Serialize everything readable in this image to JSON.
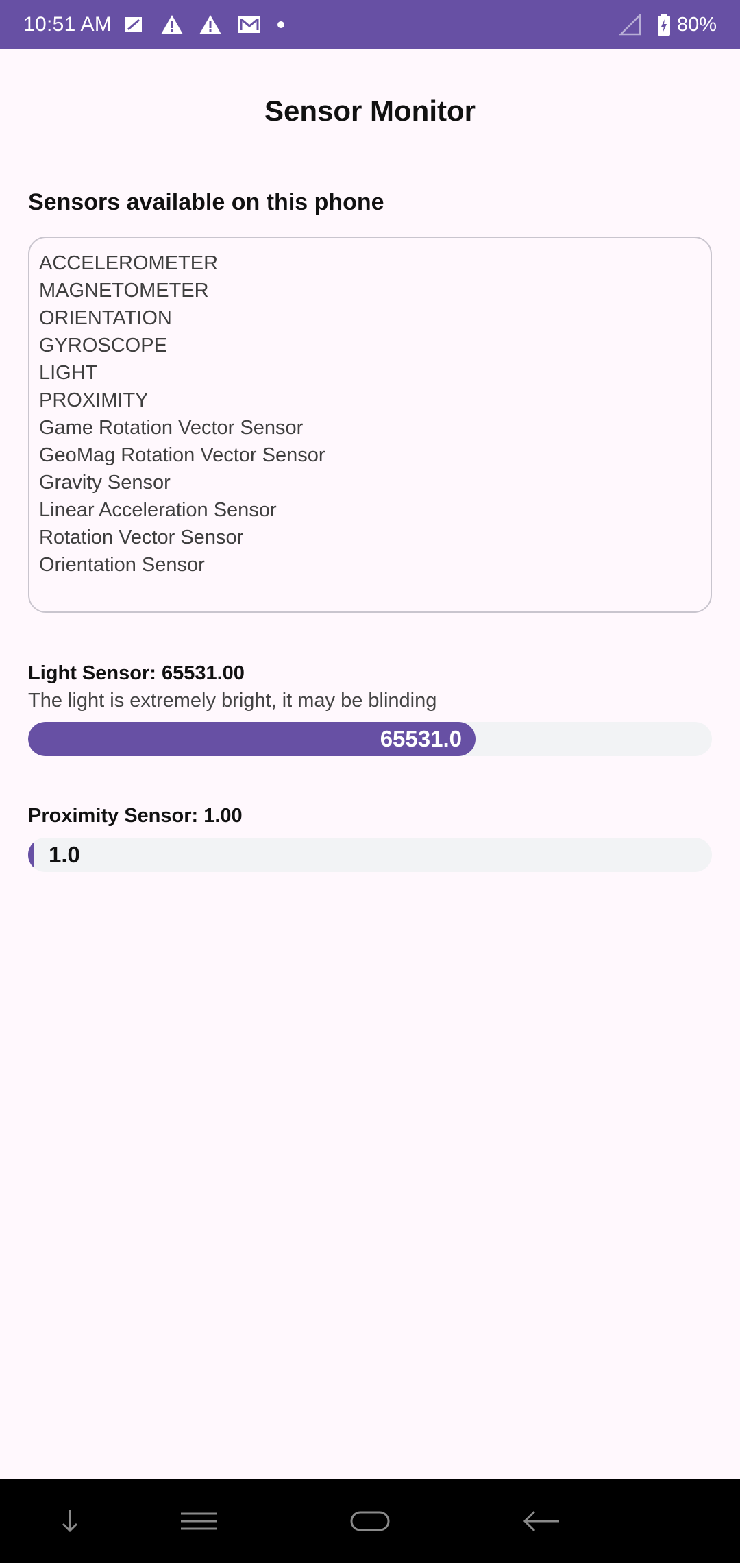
{
  "status_bar": {
    "time": "10:51 AM",
    "battery": "80%",
    "icons": [
      "sim-card-icon",
      "warning-icon",
      "warning-icon",
      "gmail-icon",
      "dot-icon",
      "signal-icon",
      "battery-charging-icon"
    ]
  },
  "app": {
    "title": "Sensor Monitor"
  },
  "sensors_section": {
    "heading": "Sensors available on this phone",
    "items": [
      "ACCELEROMETER",
      "MAGNETOMETER",
      "ORIENTATION",
      "GYROSCOPE",
      "LIGHT",
      "PROXIMITY",
      "Game Rotation Vector Sensor",
      "GeoMag Rotation Vector Sensor",
      "Gravity Sensor",
      "Linear Acceleration Sensor",
      "Rotation Vector Sensor",
      "Orientation Sensor"
    ]
  },
  "light_sensor": {
    "label": "Light Sensor: 65531.00",
    "description": "The light is extremely bright, it may be blinding",
    "bar_text": "65531.0",
    "level_fraction": 0.655
  },
  "proximity_sensor": {
    "label": "Proximity Sensor: 1.00",
    "bar_text": "1.0",
    "level_fraction": 0.01
  },
  "nav_bar": {
    "buttons": [
      "down-arrow-icon",
      "menu-icon",
      "home-icon",
      "back-icon"
    ]
  },
  "colors": {
    "accent": "#6750A4",
    "background": "#FFF8FD",
    "track": "#F2F3F5"
  }
}
